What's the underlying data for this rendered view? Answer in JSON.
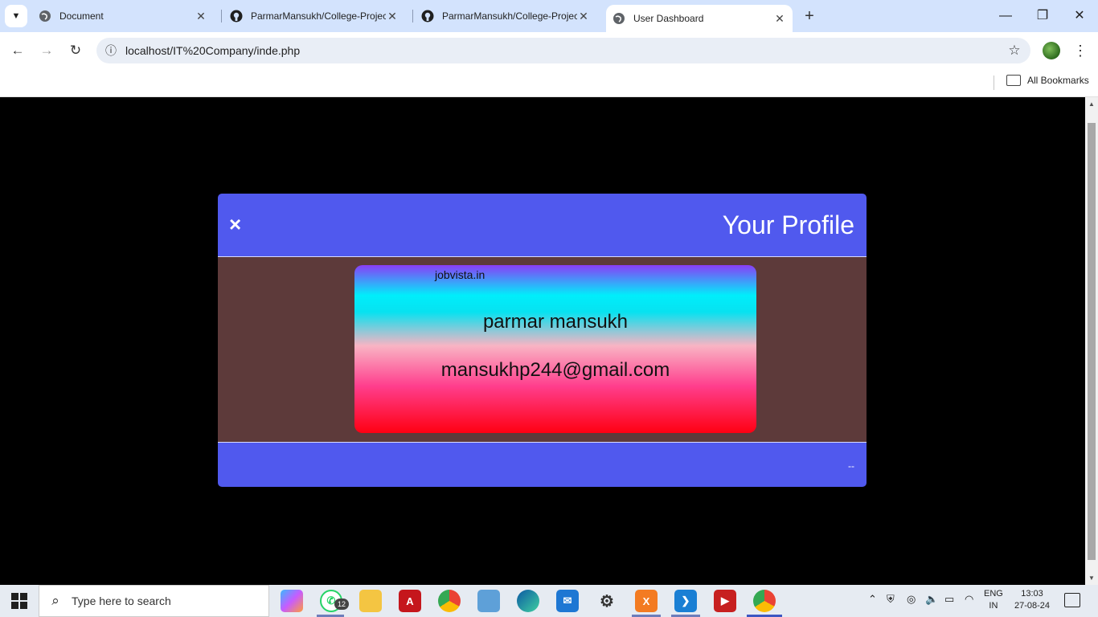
{
  "browser": {
    "tabs": [
      {
        "title": "Document",
        "icon": "globe-icon",
        "active": false
      },
      {
        "title": "ParmarMansukh/College-Projec",
        "icon": "github-icon",
        "active": false
      },
      {
        "title": "ParmarMansukh/College-Projec",
        "icon": "github-icon",
        "active": false
      },
      {
        "title": "User Dashboard",
        "icon": "globe-icon",
        "active": true
      }
    ],
    "url": "localhost/IT%20Company/inde.php",
    "bookmarks_label": "All Bookmarks"
  },
  "modal": {
    "close_label": "×",
    "title": "Your Profile",
    "footer_text": "--"
  },
  "card": {
    "brand": "jobvista.in",
    "name": "parmar mansukh",
    "email": "mansukhp244@gmail.com"
  },
  "taskbar": {
    "search_placeholder": "Type here to search",
    "whatsapp_badge": "12",
    "lang_line1": "ENG",
    "lang_line2": "IN",
    "time": "13:03",
    "date": "27-08-24"
  },
  "colors": {
    "modal_header": "#5059ee",
    "modal_body": "#5d3a3a",
    "page_bg": "#000000"
  }
}
